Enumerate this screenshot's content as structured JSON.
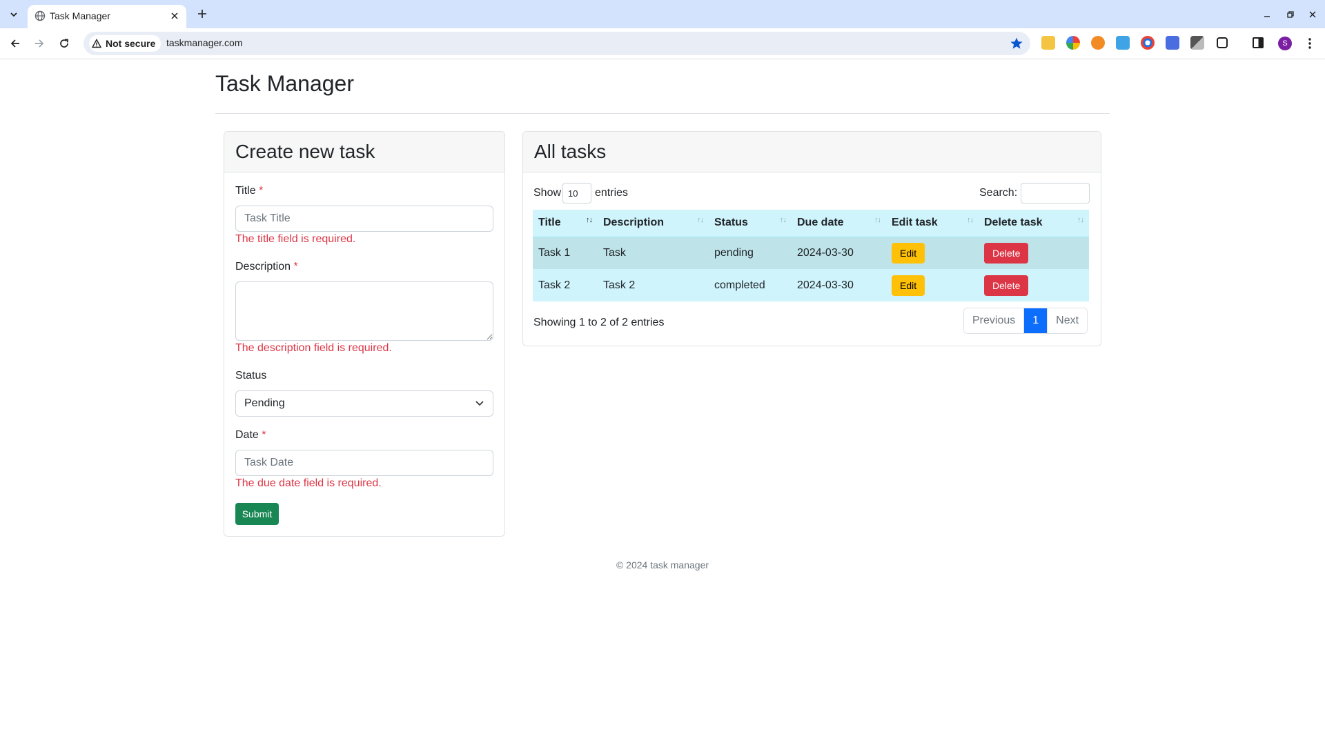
{
  "browser": {
    "tab_title": "Task Manager",
    "security_label": "Not secure",
    "url": "taskmanager.com",
    "profile_initial": "S"
  },
  "page": {
    "title": "Task Manager",
    "footer": "© 2024 task manager"
  },
  "create_form": {
    "heading": "Create new task",
    "title_label": "Title",
    "title_placeholder": "Task Title",
    "title_error": "The title field is required.",
    "description_label": "Description",
    "description_error": "The description field is required.",
    "status_label": "Status",
    "status_value": "Pending",
    "date_label": "Date",
    "date_placeholder": "Task Date",
    "date_error": "The due date field is required.",
    "required_mark": "*",
    "submit_label": "Submit"
  },
  "task_list": {
    "heading": "All tasks",
    "show_label": "Show",
    "entries_value": "10",
    "entries_label": "entries",
    "search_label": "Search:",
    "columns": [
      "Title",
      "Description",
      "Status",
      "Due date",
      "Edit task",
      "Delete task"
    ],
    "rows": [
      {
        "title": "Task 1",
        "description": "Task",
        "status": "pending",
        "due": "2024-03-30",
        "edit": "Edit",
        "delete": "Delete"
      },
      {
        "title": "Task 2",
        "description": "Task 2",
        "status": "completed",
        "due": "2024-03-30",
        "edit": "Edit",
        "delete": "Delete"
      }
    ],
    "info": "Showing 1 to 2 of 2 entries",
    "pagination": {
      "previous": "Previous",
      "current": "1",
      "next": "Next"
    }
  },
  "colors": {
    "success": "#198754",
    "warning": "#ffc107",
    "danger": "#dc3545",
    "primary": "#0d6efd",
    "table_header": "#cff4fc"
  }
}
